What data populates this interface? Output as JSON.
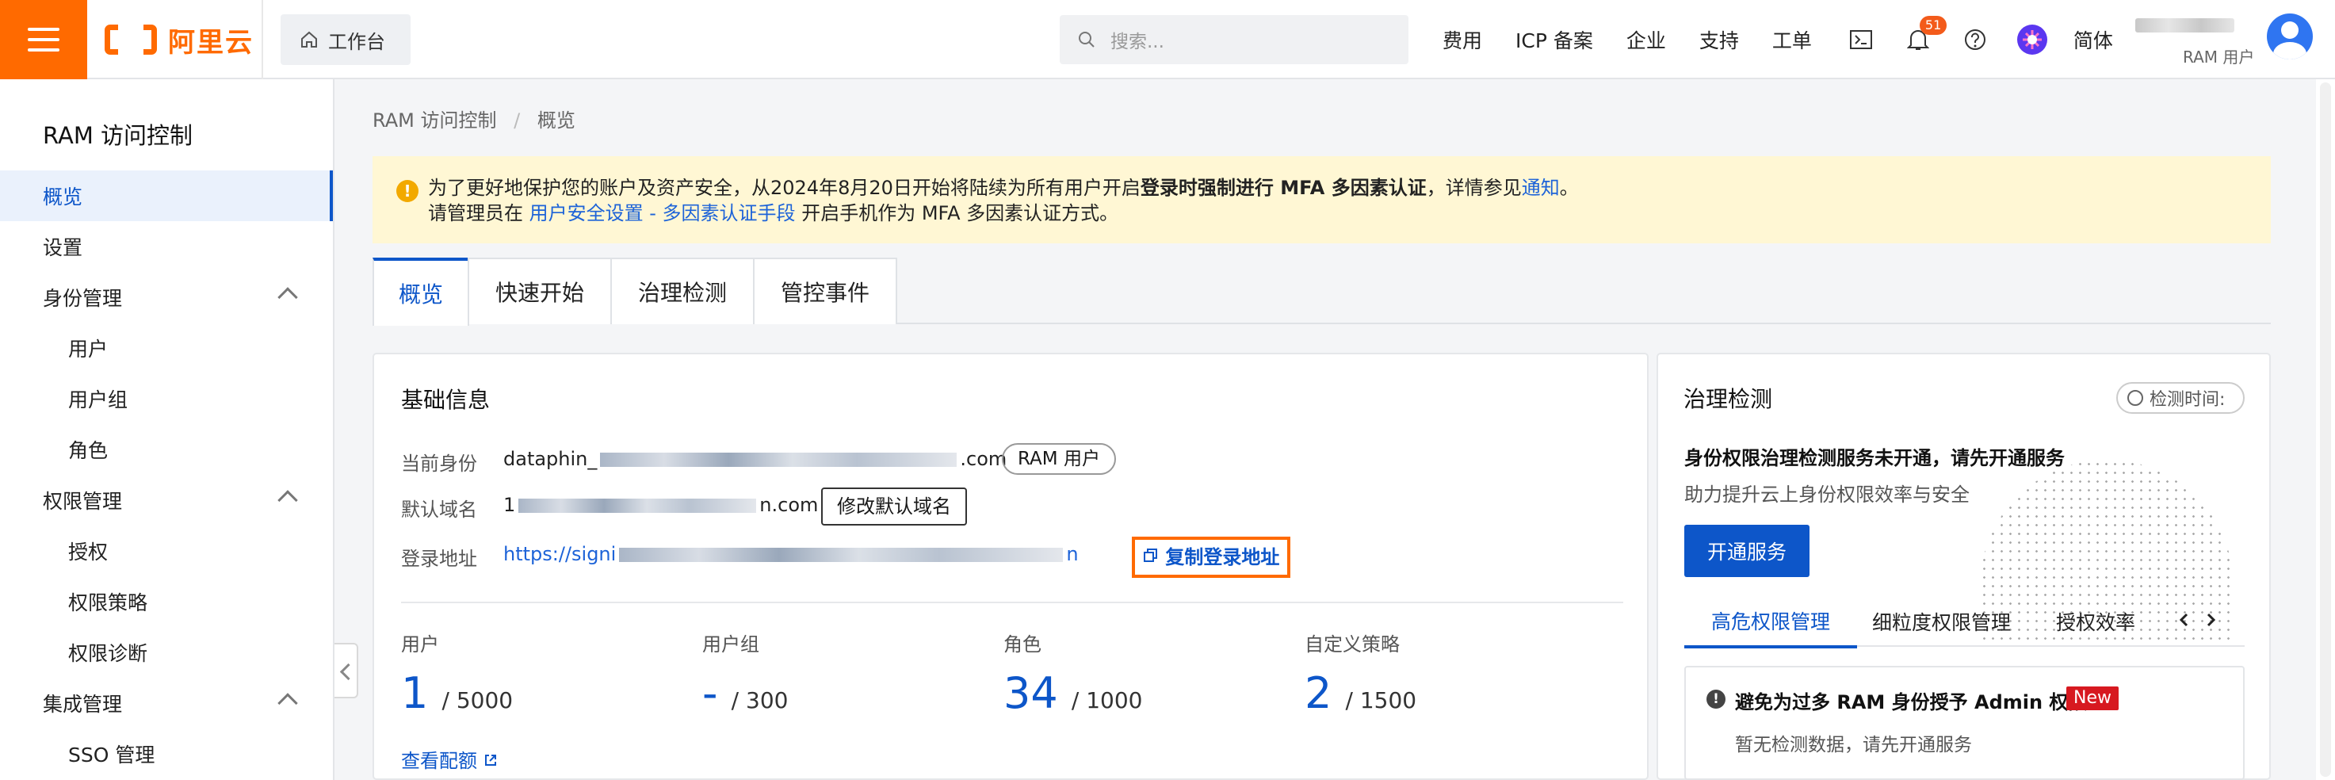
{
  "topbar": {
    "brand_name": "阿里云",
    "workbench": "工作台",
    "search_placeholder": "搜索...",
    "nav_items": [
      "费用",
      "ICP 备案",
      "企业",
      "支持",
      "工单"
    ],
    "notification_count": "51",
    "language": "简体",
    "user_role": "RAM 用户"
  },
  "sidebar": {
    "title": "RAM 访问控制",
    "items": [
      {
        "label": "概览",
        "active": true
      },
      {
        "label": "设置"
      },
      {
        "label": "身份管理",
        "expanded": true
      },
      {
        "label": "用户"
      },
      {
        "label": "用户组"
      },
      {
        "label": "角色"
      },
      {
        "label": "权限管理",
        "expanded": true
      },
      {
        "label": "授权"
      },
      {
        "label": "权限策略"
      },
      {
        "label": "权限诊断"
      },
      {
        "label": "集成管理",
        "expanded": true
      },
      {
        "label": "SSO 管理"
      }
    ]
  },
  "breadcrumb": {
    "root": "RAM 访问控制",
    "current": "概览"
  },
  "notice": {
    "line1_prefix": "为了更好地保护您的账户及资产安全，从2024年8月20日开始将陆续为所有用户开启",
    "line1_bold": "登录时强制进行 MFA 多因素认证",
    "line1_middle": "，详情参见",
    "line1_link": "通知",
    "line1_suffix": "。",
    "line2_prefix": "请管理员在",
    "line2_link": "用户安全设置 - 多因素认证手段",
    "line2_suffix": "开启手机作为 MFA 多因素认证方式。"
  },
  "tabs": [
    "概览",
    "快速开始",
    "治理检测",
    "管控事件"
  ],
  "basic_info": {
    "title": "基础信息",
    "identity_label": "当前身份",
    "identity_value_start": "dataphin_",
    "identity_value_end": ".com",
    "identity_tag": "RAM 用户",
    "domain_label": "默认域名",
    "domain_value_start": "1",
    "domain_value_end": "n.com",
    "modify_domain_button": "修改默认域名",
    "login_label": "登录地址",
    "login_value_start": "https://signi",
    "login_value_end": "n",
    "copy_login_button": "复制登录地址",
    "stats": [
      {
        "label": "用户",
        "value": "1",
        "total": "/ 5000"
      },
      {
        "label": "用户组",
        "value": "-",
        "total": "/ 300"
      },
      {
        "label": "角色",
        "value": "34",
        "total": "/ 1000"
      },
      {
        "label": "自定义策略",
        "value": "2",
        "total": "/ 1500"
      }
    ],
    "quota_link": "查看配额"
  },
  "governance": {
    "title": "治理检测",
    "time_chip": "检测时间:",
    "heading": "身份权限治理检测服务未开通，请先开通服务",
    "description": "助力提升云上身份权限效率与安全",
    "button": "开通服务",
    "subtabs": [
      "高危权限管理",
      "细粒度权限管理",
      "授权效率"
    ],
    "alert_title": "避免为过多 RAM 身份授予 Admin 权限",
    "alert_badge": "New",
    "alert_text": "暂无检测数据，请先开通服务"
  },
  "colors": {
    "brand": "#ff6a00",
    "primary": "#0d56c9",
    "notice_background": "#fff7d4"
  }
}
